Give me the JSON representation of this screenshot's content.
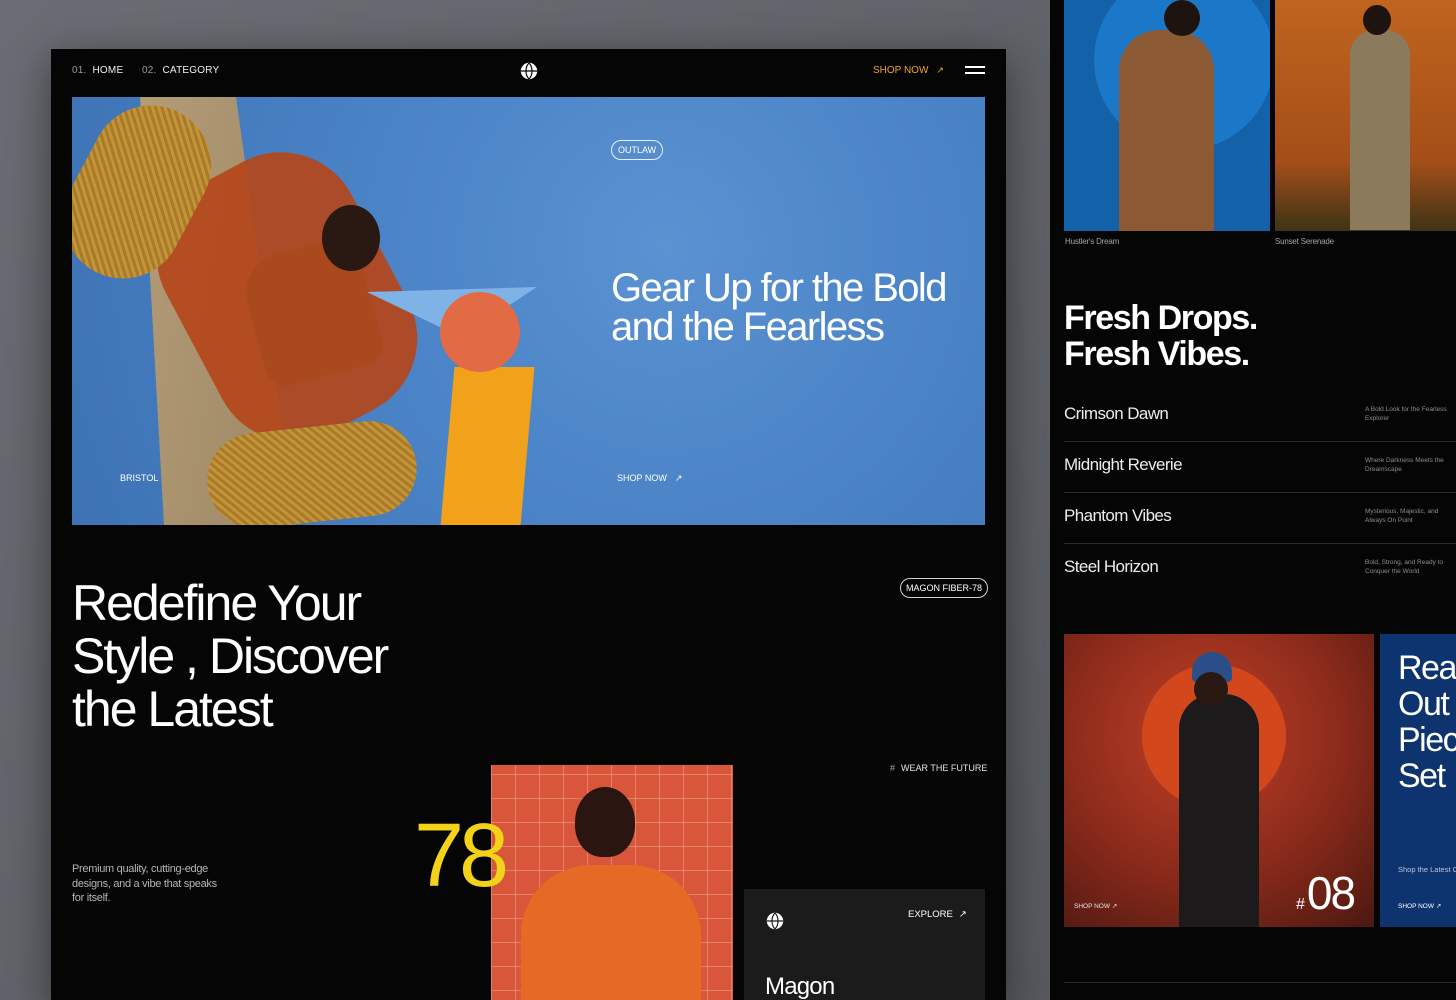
{
  "nav": {
    "items": [
      {
        "num": "01.",
        "label": "HOME"
      },
      {
        "num": "02.",
        "label": "CATEGORY"
      }
    ],
    "shop_label": "SHOP NOW",
    "shop_arrow": "↗",
    "logo_icon": "globe-icon",
    "menu_icon": "hamburger-menu-icon"
  },
  "hero": {
    "tag": "OUTLAW",
    "title": "Gear Up for the Bold and the Fearless",
    "shop_label": "SHOP NOW",
    "shop_arrow": "↗",
    "location": "BRISTOL"
  },
  "section": {
    "heading": "Redefine Your Style , Discover the Latest",
    "badge": "MAGON FIBER-78",
    "tagline_hash": "#",
    "tagline": "WEAR THE FUTURE",
    "description": "Premium quality, cutting-edge designs, and a vibe that speaks for itself.",
    "big_number": "78",
    "card": {
      "explore_label": "EXPLORE",
      "explore_arrow": "↗",
      "title": "Magon"
    }
  },
  "right_panel": {
    "captions": [
      "Hustler's Dream",
      "Sunset Serenade"
    ],
    "heading": "Fresh Drops. Fresh Vibes.",
    "list": [
      {
        "name": "Crimson Dawn",
        "desc": "A Bold Look for the Fearless Explorer"
      },
      {
        "name": "Midnight Reverie",
        "desc": "Where Darkness Meets the Dreamscape"
      },
      {
        "name": "Phantom Vibes",
        "desc": "Mysterious, Majestic, and Always On Point"
      },
      {
        "name": "Steel Horizon",
        "desc": "Bold, Strong, and Ready to Conquer the World"
      }
    ],
    "card1": {
      "shop_label": "SHOP NOW",
      "shop_arrow": "↗",
      "hash": "#",
      "number": "08"
    },
    "card2": {
      "title": "Rea\nOut\nPiec\nSet",
      "subtitle": "Shop the Latest C Your Wardrobe To",
      "shop_label": "SHOP NOW",
      "shop_arrow": "↗"
    }
  },
  "colors": {
    "background": "#5e6066",
    "panel": "#050505",
    "hero_blue": "#4a83c6",
    "accent_orange": "#f0a823",
    "accent_yellow": "#f3d21a"
  }
}
